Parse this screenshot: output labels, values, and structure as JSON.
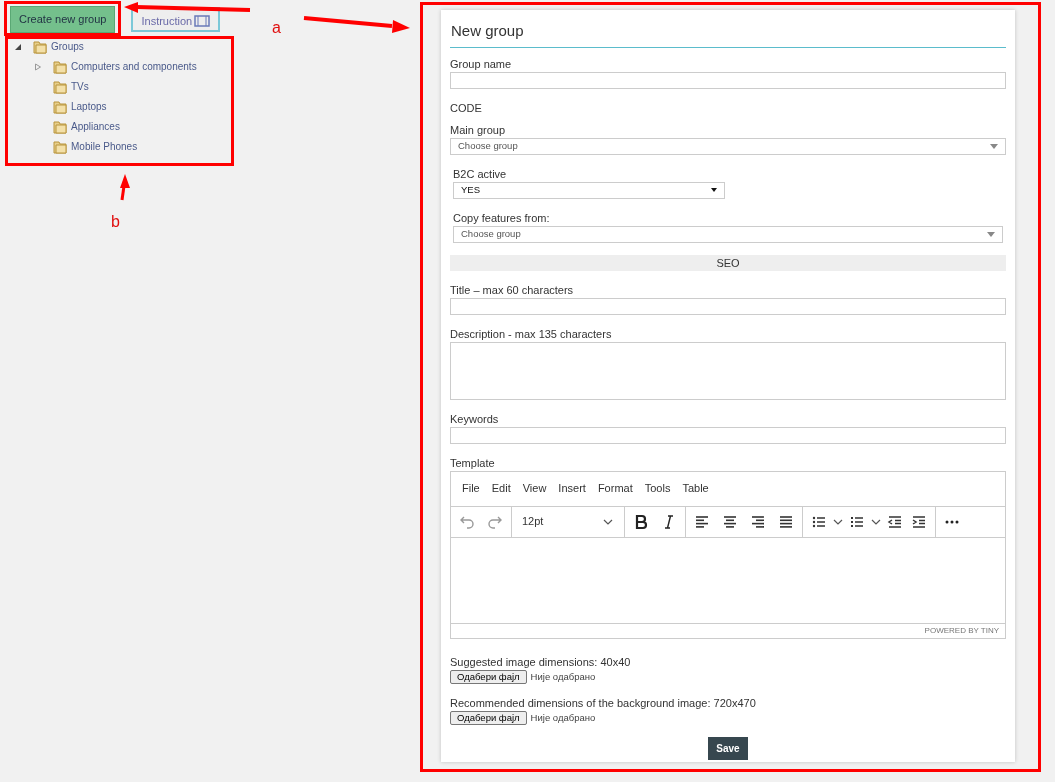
{
  "toolbar": {
    "create_button": "Create new group",
    "instruction_button": "Instruction"
  },
  "tree": {
    "label": "Groups",
    "expanded": true,
    "children": [
      {
        "label": "Computers and components",
        "expandable": true
      },
      {
        "label": "TVs",
        "expandable": false
      },
      {
        "label": "Laptops",
        "expandable": false
      },
      {
        "label": "Appliances",
        "expandable": false
      },
      {
        "label": "Mobile Phones",
        "expandable": false
      }
    ]
  },
  "annotations": [
    {
      "label": "a"
    },
    {
      "label": "b"
    }
  ],
  "form": {
    "title": "New group",
    "fields": [
      {
        "kind": "input",
        "label": "Group name"
      },
      {
        "kind": "text",
        "label": "CODE"
      },
      {
        "kind": "select",
        "label": "Main group",
        "value": "Choose group"
      },
      {
        "kind": "select-short",
        "label": "B2C active",
        "value": "YES"
      },
      {
        "kind": "select-inset",
        "label": "Copy features from:",
        "value": "Choose group"
      },
      {
        "kind": "section",
        "label": "SEO"
      },
      {
        "kind": "input",
        "label": "Title – max 60 characters"
      },
      {
        "kind": "textarea",
        "label": "Description - max 135 characters"
      },
      {
        "kind": "input",
        "label": "Keywords"
      },
      {
        "kind": "editor",
        "label": "Template",
        "menu": [
          "File",
          "Edit",
          "View",
          "Insert",
          "Format",
          "Tools",
          "Table"
        ],
        "font_size": "12pt",
        "branding": "POWERED BY TINY"
      },
      {
        "kind": "file",
        "label": "Suggested image dimensions: 40x40",
        "button": "Одабери фајл",
        "status": "Није одабрано"
      },
      {
        "kind": "file",
        "label": "Recommended dimensions of the background image: 720x470",
        "button": "Одабери фајл",
        "status": "Није одабрано"
      }
    ],
    "save": "Save"
  }
}
